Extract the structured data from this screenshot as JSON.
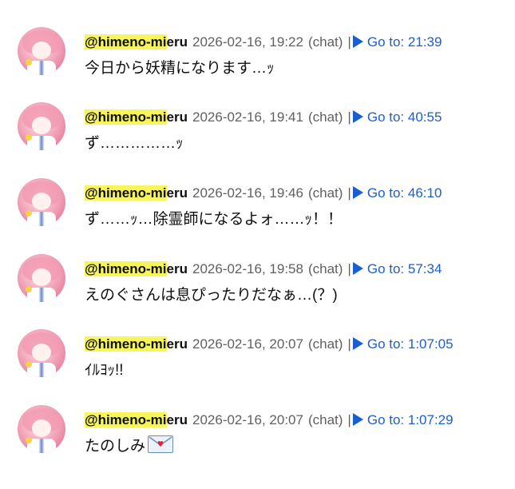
{
  "messages": [
    {
      "author_highlight": "@himeno-mi",
      "author_rest": "eru",
      "timestamp": "2026-02-16, 19:22",
      "tag": "(chat)",
      "separator": "|",
      "goto": "Go to: 21:39",
      "text": "今日から妖精になります…ｯ"
    },
    {
      "author_highlight": "@himeno-mi",
      "author_rest": "eru",
      "timestamp": "2026-02-16, 19:41",
      "tag": "(chat)",
      "separator": "|",
      "goto": "Go to: 40:55",
      "text": "ず……………ｯ"
    },
    {
      "author_highlight": "@himeno-mi",
      "author_rest": "eru",
      "timestamp": "2026-02-16, 19:46",
      "tag": "(chat)",
      "separator": "|",
      "goto": "Go to: 46:10",
      "text": "ず……ｯ…除霊師になるよォ……ｯ！！"
    },
    {
      "author_highlight": "@himeno-mi",
      "author_rest": "eru",
      "timestamp": "2026-02-16, 19:58",
      "tag": "(chat)",
      "separator": "|",
      "goto": "Go to: 57:34",
      "text": "えのぐさんは息ぴったりだなぁ…(？)"
    },
    {
      "author_highlight": "@himeno-mi",
      "author_rest": "eru",
      "timestamp": "2026-02-16, 20:07",
      "tag": "(chat)",
      "separator": "|",
      "goto": "Go to: 1:07:05",
      "text": "ｲﾙﾖｯ!!"
    },
    {
      "author_highlight": "@himeno-mi",
      "author_rest": "eru",
      "timestamp": "2026-02-16, 20:07",
      "tag": "(chat)",
      "separator": "|",
      "goto": "Go to: 1:07:29",
      "text": "たのしみ",
      "emoji": "love-letter-icon"
    }
  ],
  "colors": {
    "link": "#1a5fd1",
    "meta": "#606060",
    "highlight": "#f7f55a"
  }
}
